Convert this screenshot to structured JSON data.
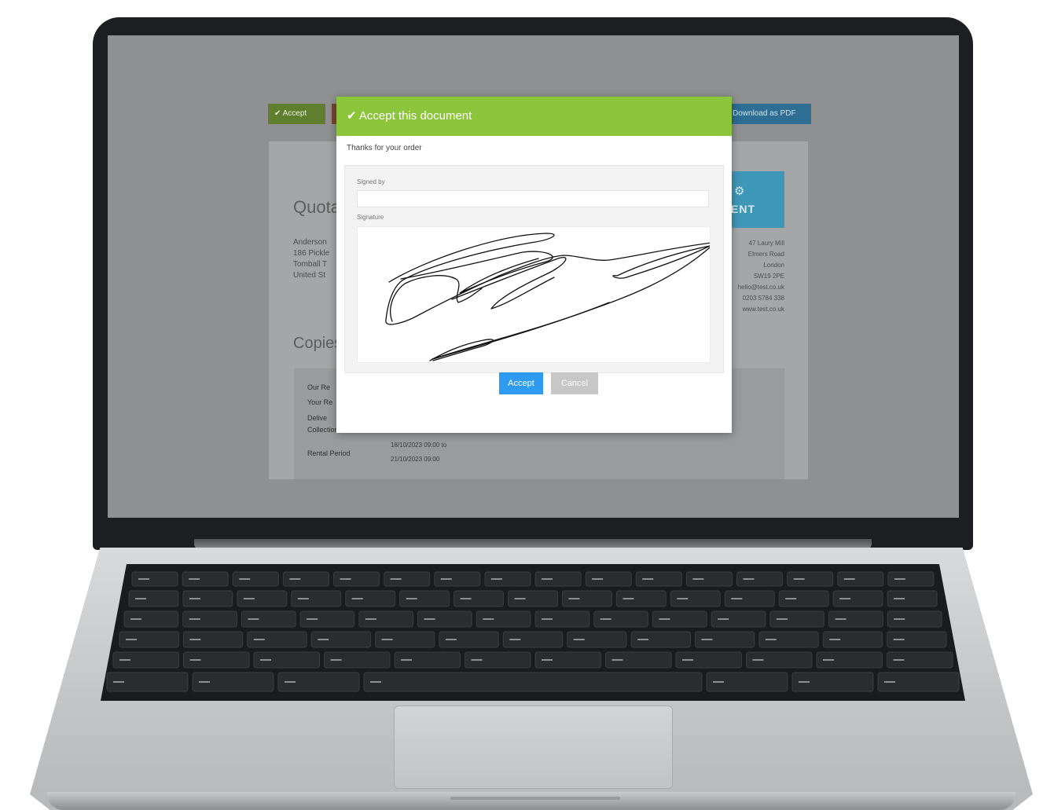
{
  "toolbar": {
    "accept_label": "✔ Accept",
    "download_label": "Download as PDF"
  },
  "document": {
    "title": "Quotation",
    "address_lines": [
      "Anderson",
      "186 Pickle",
      "Tomball T",
      "United St"
    ],
    "brand_text": "ENT",
    "right_address_lines": [
      "47 Laury Mill",
      "Elmers Road",
      "London",
      "SW19 2PE",
      "hello@test.co.uk",
      "0203 5784 338",
      "www.test.co.uk"
    ],
    "copies_title": "Copies",
    "info_rows": [
      {
        "label": "Our Re",
        "value": ""
      },
      {
        "label": "Your Re",
        "value": ""
      },
      {
        "label": "Delive",
        "value": ""
      },
      {
        "label": "Collection",
        "value": ""
      },
      {
        "label": "Rental Period",
        "value": "18/10/2023 09:00 to",
        "value2": "21/10/2023 09:00"
      }
    ]
  },
  "modal": {
    "title": "✔ Accept this document",
    "subtitle": "Thanks for your order",
    "signed_by_label": "Signed by",
    "signed_by_value": "",
    "signature_label": "Signature",
    "accept_label": "Accept",
    "cancel_label": "Cancel"
  },
  "colors": {
    "modal_header": "#8cc43a",
    "accept_button": "#2e9bf0",
    "cancel_button": "#c7c7c7",
    "download_button": "#2d8fc6"
  }
}
